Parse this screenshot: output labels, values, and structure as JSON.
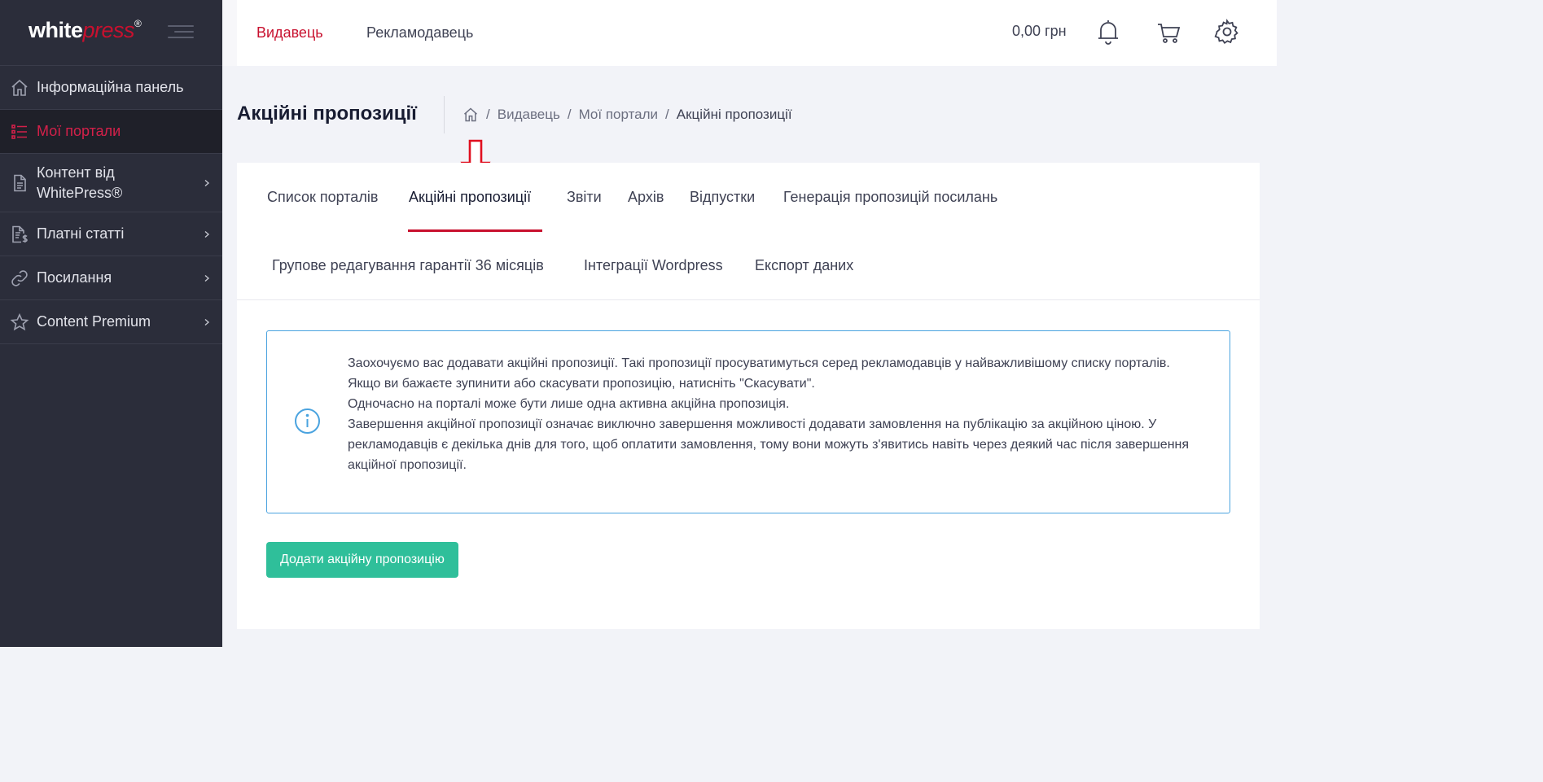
{
  "brand": {
    "name_white": "white",
    "name_press": "press",
    "reg": "®"
  },
  "sidebar": {
    "items": [
      {
        "label": "Інформаційна панель",
        "icon": "home-icon",
        "active": false,
        "has_children": false
      },
      {
        "label": "Мої портали",
        "icon": "list-icon",
        "active": true,
        "has_children": false
      },
      {
        "label": "Контент від WhitePress®",
        "icon": "document-icon",
        "active": false,
        "has_children": true
      },
      {
        "label": "Платні статті",
        "icon": "paid-document-icon",
        "active": false,
        "has_children": true
      },
      {
        "label": "Посилання",
        "icon": "link-icon",
        "active": false,
        "has_children": true
      },
      {
        "label": "Content Premium",
        "icon": "star-icon",
        "active": false,
        "has_children": true
      }
    ]
  },
  "topbar": {
    "tabs": [
      {
        "label": "Видавець",
        "active": true
      },
      {
        "label": "Рекламодавець",
        "active": false
      }
    ],
    "balance": "0,00 грн",
    "icons": [
      "bell-icon",
      "cart-icon",
      "gear-icon"
    ]
  },
  "page": {
    "title": "Акційні пропозиції",
    "breadcrumb": [
      "Видавець",
      "Мої портали",
      "Акційні пропозиції"
    ]
  },
  "tabs": {
    "row1": [
      "Список порталів",
      "Акційні пропозиції",
      "Звіти",
      "Архів",
      "Відпустки",
      "Генерація пропозицій посилань"
    ],
    "row2": [
      "Групове редагування гарантії 36 місяців",
      "Інтеграції Wordpress",
      "Експорт даних"
    ],
    "active": "Акційні пропозиції"
  },
  "notice": {
    "lines": [
      "Заохочуємо вас додавати акційні пропозиції. Такі пропозиції просуватимуться серед рекламодавців у найважливішому списку порталів.",
      "Якщо ви бажаєте зупинити або скасувати пропозицію, натисніть \"Скасувати\".",
      "Одночасно на порталі може бути лише одна активна акційна пропозиція.",
      "Завершення акційної пропозиції означає виключно завершення можливості додавати замовлення на публікацію за акційною ціною. У рекламодавців є декілька днів для того, щоб оплатити замовлення, тому вони можуть з'явитись навіть через деякий час після завершення акційної пропозиції."
    ]
  },
  "actions": {
    "add_label": "Додати акційну пропозицію"
  },
  "colors": {
    "accent": "#c8102e",
    "sidebar_bg": "#2b2d3a",
    "button": "#2fbf9a",
    "info": "#4aa3df"
  }
}
